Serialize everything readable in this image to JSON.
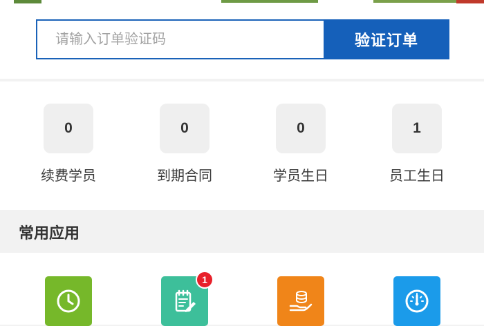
{
  "verify": {
    "placeholder": "请输入订单验证码",
    "value": "",
    "button_label": "验证订单",
    "accent_color": "#1560ba"
  },
  "stats": [
    {
      "value": "0",
      "label": "续费学员"
    },
    {
      "value": "0",
      "label": "到期合同"
    },
    {
      "value": "0",
      "label": "学员生日"
    },
    {
      "value": "1",
      "label": "员工生日"
    }
  ],
  "section_title": "常用应用",
  "apps": [
    {
      "icon": "clock-icon",
      "color": "#76b82a"
    },
    {
      "icon": "notepad-edit-icon",
      "color": "#3dbf9a",
      "badge": "1"
    },
    {
      "icon": "coins-hand-icon",
      "color": "#f08519"
    },
    {
      "icon": "gauge-icon",
      "color": "#1b9bea"
    }
  ]
}
